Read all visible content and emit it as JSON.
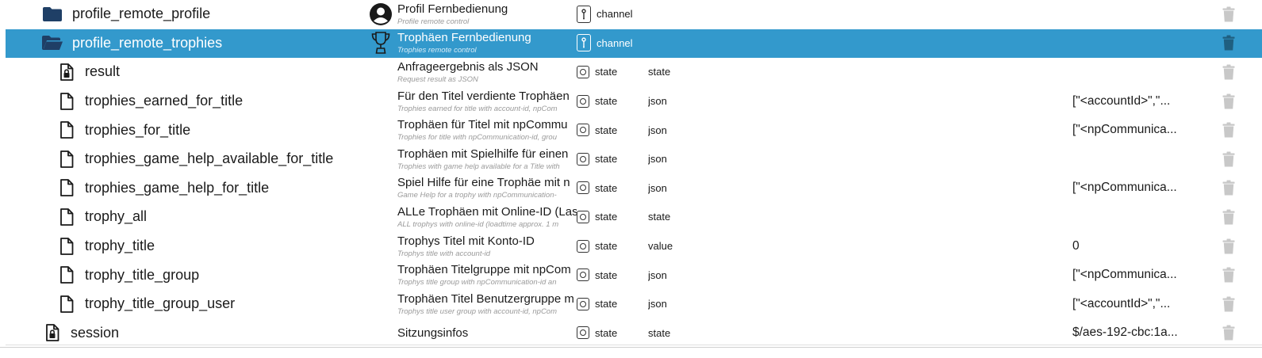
{
  "rows": [
    {
      "depth": 0,
      "icon": "folder-icon",
      "name": "profile_remote_profile",
      "title_icon": "user-avatar-icon",
      "title": "Profil Fernbedienung",
      "subtitle": "Profile remote control",
      "type": "channel",
      "role": "",
      "value": ""
    },
    {
      "depth": 0,
      "icon": "folder-open-icon",
      "name": "profile_remote_trophies",
      "title_icon": "trophy-icon",
      "title": "Trophäen Fernbedienung",
      "subtitle": "Trophies remote control",
      "type": "channel",
      "role": "",
      "value": "",
      "selected": true
    },
    {
      "depth": 1,
      "icon": "file-lock-icon",
      "name": "result",
      "title": "Anfrageergebnis als JSON",
      "subtitle": "Request result as JSON",
      "type": "state",
      "role": "state",
      "value": ""
    },
    {
      "depth": 1,
      "icon": "file-icon",
      "name": "trophies_earned_for_title",
      "title": "Für den Titel verdiente Trophäen",
      "subtitle": "Trophies earned for title with account-id, npCom",
      "type": "state",
      "role": "json",
      "value": "[\"<accountId>\",\"..."
    },
    {
      "depth": 1,
      "icon": "file-icon",
      "name": "trophies_for_title",
      "title": "Trophäen für Titel mit npCommu",
      "subtitle": "Trophies for title with npCommunication-id, grou",
      "type": "state",
      "role": "json",
      "value": "[\"<npCommunica..."
    },
    {
      "depth": 1,
      "icon": "file-icon",
      "name": "trophies_game_help_available_for_title",
      "title": "Trophäen mit Spielhilfe für einen",
      "subtitle": "Trophies with game help available for a Title with",
      "type": "state",
      "role": "json",
      "value": ""
    },
    {
      "depth": 1,
      "icon": "file-icon",
      "name": "trophies_game_help_for_title",
      "title": "Spiel Hilfe für eine Trophäe mit n",
      "subtitle": "Game Help for a trophy with npCommunication-",
      "type": "state",
      "role": "json",
      "value": "[\"<npCommunica..."
    },
    {
      "depth": 1,
      "icon": "file-icon",
      "name": "trophy_all",
      "title": "ALLe Trophäen mit Online-ID (Las",
      "subtitle": "ALL trophys with online-id (loadtime approx. 1 m",
      "type": "state",
      "role": "state",
      "value": ""
    },
    {
      "depth": 1,
      "icon": "file-icon",
      "name": "trophy_title",
      "title": "Trophys Titel mit Konto-ID",
      "subtitle": "Trophys title with account-id",
      "type": "state",
      "role": "value",
      "value": "0"
    },
    {
      "depth": 1,
      "icon": "file-icon",
      "name": "trophy_title_group",
      "title": "Trophäen Titelgruppe mit npCom",
      "subtitle": "Trophys title group with npCommunication-id an",
      "type": "state",
      "role": "json",
      "value": "[\"<npCommunica..."
    },
    {
      "depth": 1,
      "icon": "file-icon",
      "name": "trophy_title_group_user",
      "title": "Trophäen Titel Benutzergruppe m",
      "subtitle": "Trophys title user group with account-id, npCom",
      "type": "state",
      "role": "json",
      "value": "[\"<accountId>\",\"..."
    },
    {
      "depth": -1,
      "icon": "file-lock-icon",
      "name": "session",
      "title": "Sitzungsinfos",
      "subtitle": "",
      "type": "state",
      "role": "state",
      "value": "$/aes-192-cbc:1a..."
    }
  ]
}
